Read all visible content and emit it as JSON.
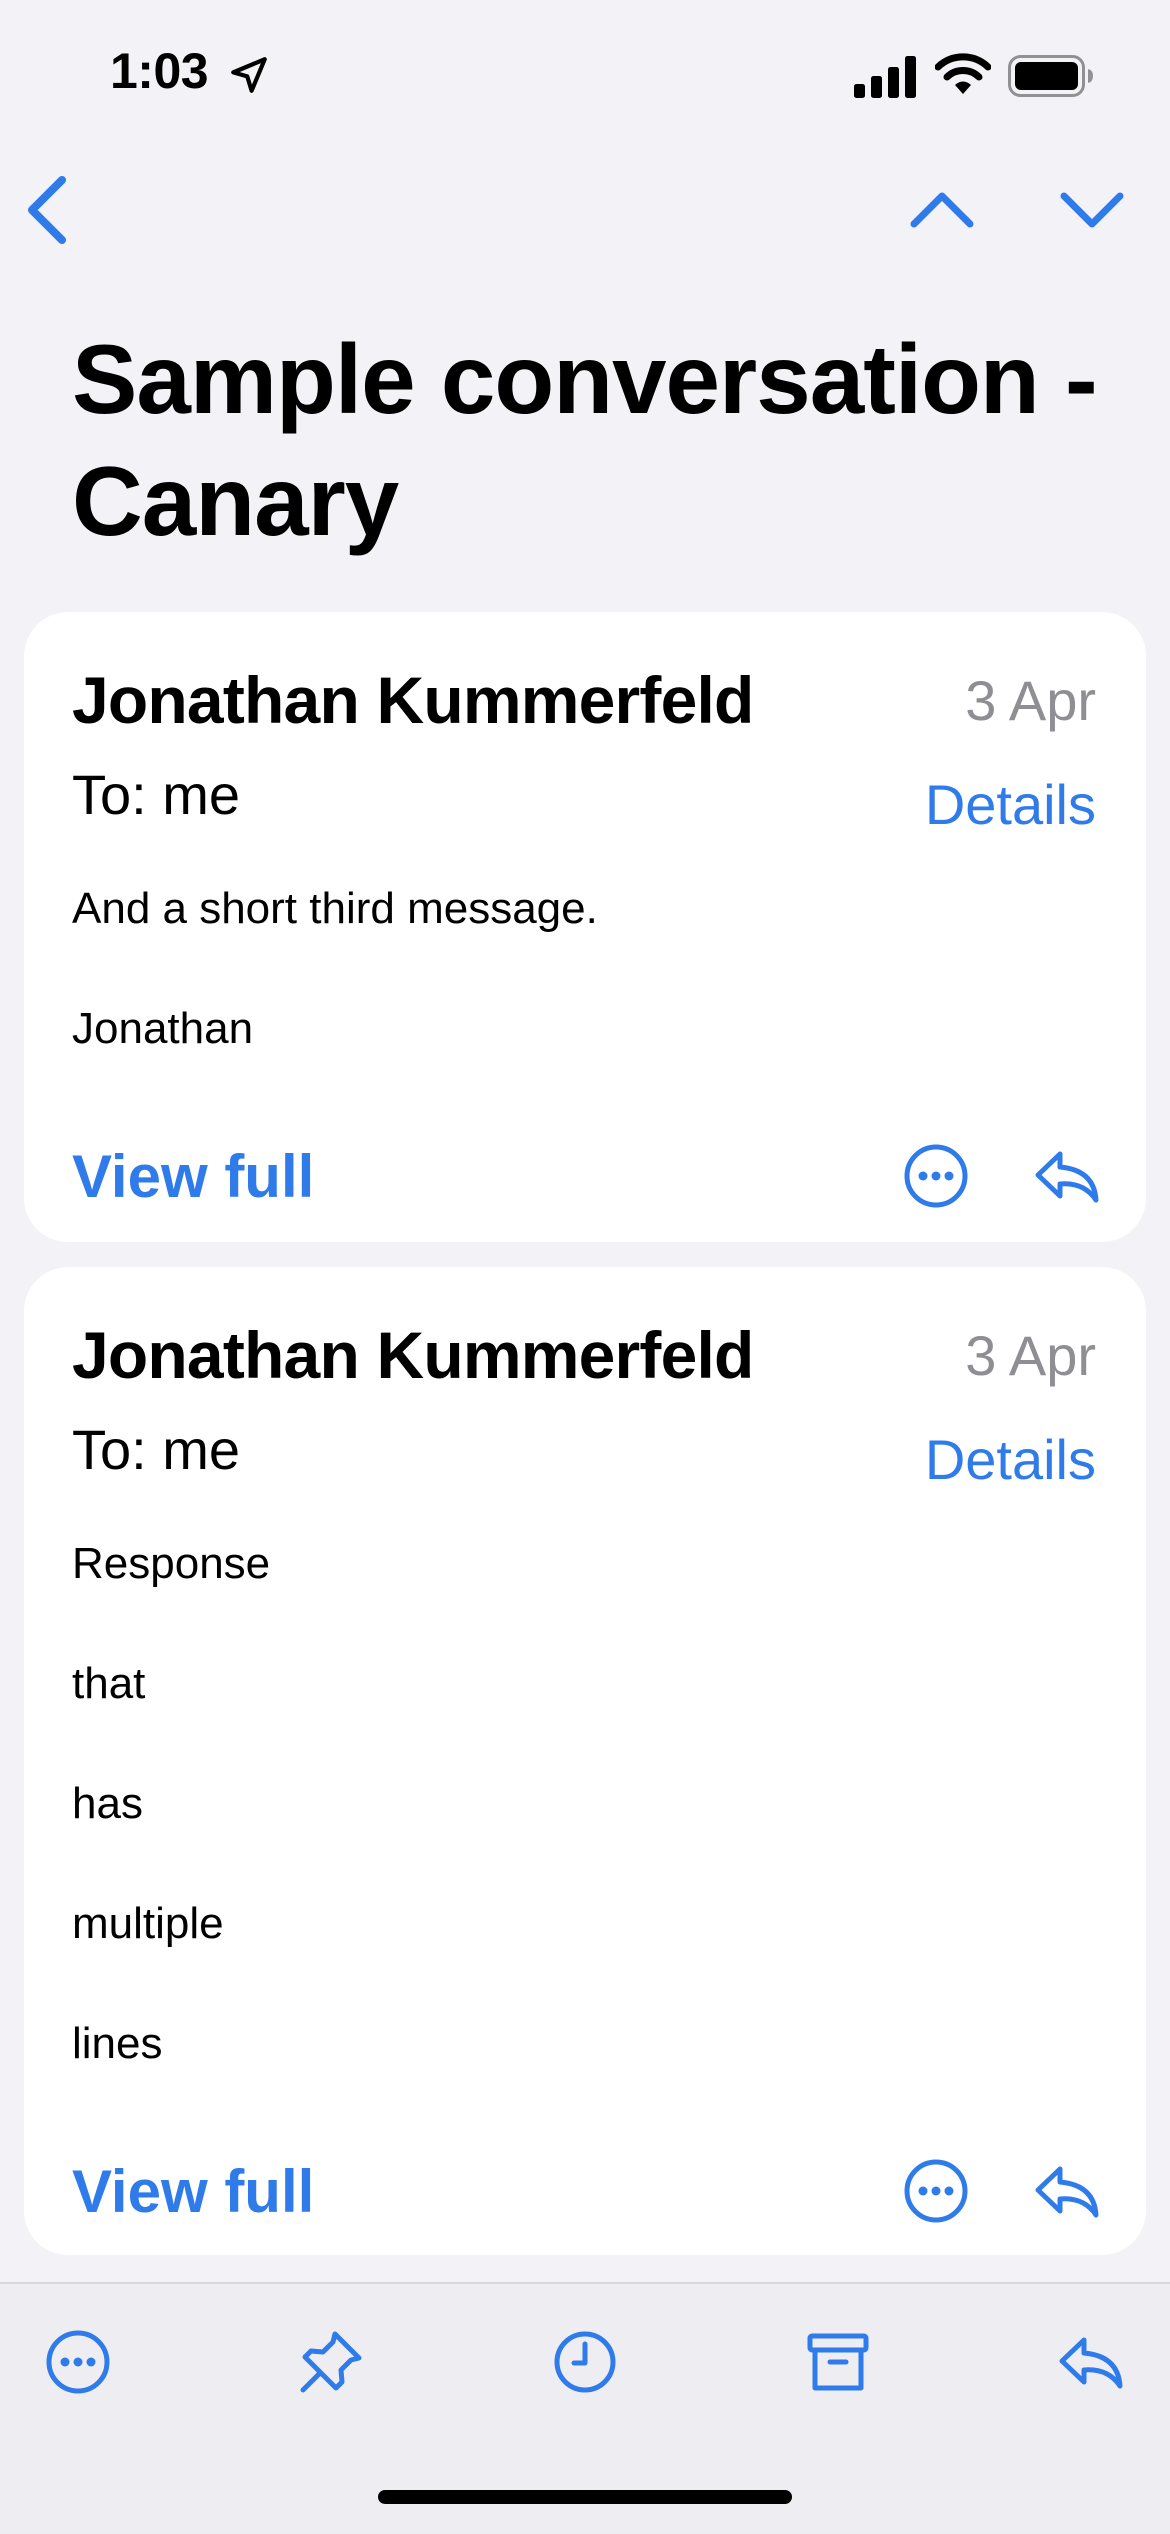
{
  "status_bar": {
    "time": "1:03",
    "icons": [
      "location-arrow-icon",
      "cellular-signal-icon",
      "wifi-icon",
      "battery-icon"
    ]
  },
  "nav": {
    "icons": [
      "chevron-left-icon",
      "chevron-up-icon",
      "chevron-down-icon"
    ]
  },
  "title": "Sample conversation - Canary",
  "messages": [
    {
      "sender": "Jonathan Kummerfeld",
      "date": "3 Apr",
      "to": "To: me",
      "details_label": "Details",
      "body": [
        "And a short third message.",
        "Jonathan"
      ],
      "view_full_label": "View full",
      "icons": [
        "more-circle-icon",
        "reply-icon"
      ]
    },
    {
      "sender": "Jonathan Kummerfeld",
      "date": "3 Apr",
      "to": "To: me",
      "details_label": "Details",
      "body": [
        "Response",
        "that",
        "has",
        "multiple",
        "lines"
      ],
      "view_full_label": "View full",
      "icons": [
        "more-circle-icon",
        "reply-icon"
      ]
    }
  ],
  "toolbar": {
    "icons": [
      "more-circle-icon",
      "pin-icon",
      "clock-icon",
      "archive-icon",
      "reply-icon"
    ]
  },
  "colors": {
    "accent": "#2f7bea",
    "background": "#f2f2f7",
    "card": "#ffffff",
    "secondary_text": "#8e8e93"
  }
}
